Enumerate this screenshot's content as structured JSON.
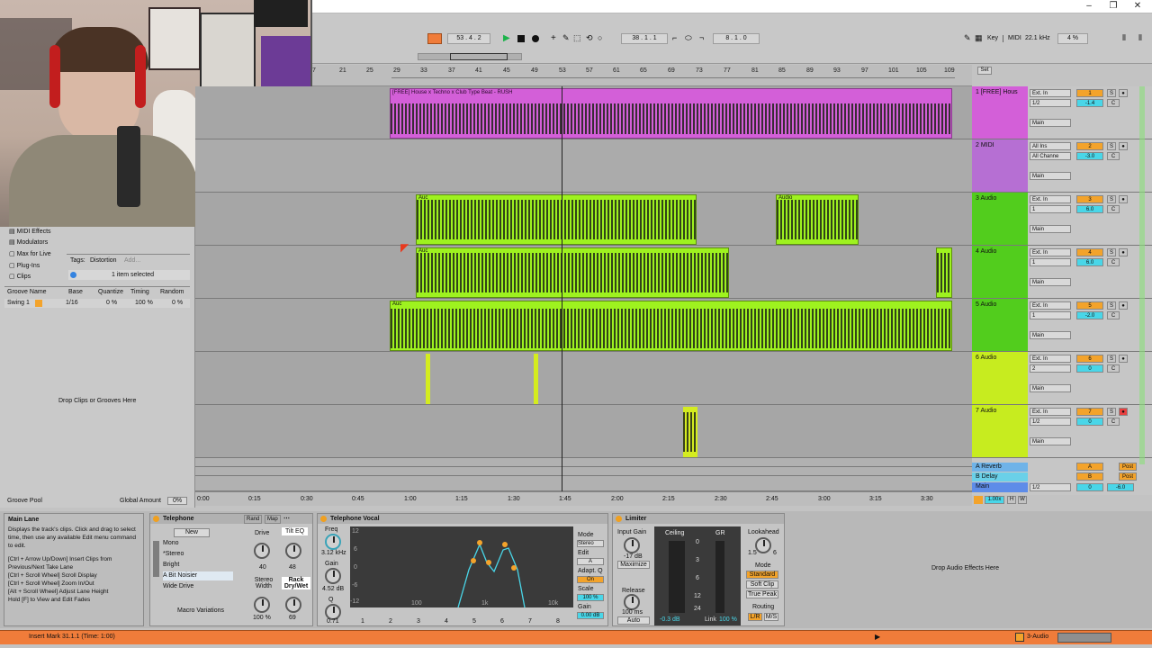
{
  "transport": {
    "position": "53 . 4 . 2",
    "loop_start": "38 . 1 . 1",
    "loop_length": "8 . 1 . 0",
    "key_label": "Key",
    "midi_label": "MIDI",
    "sample_rate": "22.1 kHz",
    "cpu": "4 %"
  },
  "ruler": {
    "bars": [
      "7",
      "21",
      "25",
      "29",
      "33",
      "37",
      "41",
      "45",
      "49",
      "53",
      "57",
      "61",
      "65",
      "69",
      "73",
      "77",
      "81",
      "85",
      "89",
      "93",
      "97",
      "101",
      "105",
      "109"
    ],
    "set_label": "Set"
  },
  "browser": {
    "categories": [
      "MIDI Effects",
      "Modulators",
      "Max for Live",
      "Plug-Ins",
      "Clips"
    ],
    "tags_label": "Tags:",
    "tag_value": "Distortion",
    "tag_add": "Add...",
    "selection_info": "1 item selected",
    "groove_headers": [
      "Groove Name",
      "Base",
      "Quantize",
      "Timing",
      "Random"
    ],
    "groove_row": {
      "name": "Swing 1",
      "base": "1/16",
      "quantize": "0 %",
      "timing": "100 %",
      "random": "0 %"
    },
    "drop_hint": "Drop Clips or Grooves Here",
    "groove_pool": "Groove Pool",
    "global_amount_label": "Global Amount",
    "global_amount": "0%"
  },
  "arrangement": {
    "clip1_name": "[FREE] House x Techno x Club Type Beat - RUSH",
    "audio_clip_label": "Audio",
    "short_clip_label": "Auc"
  },
  "tracks": [
    {
      "name": "1 [FREE] Hous",
      "input": "Ext. In",
      "channel": "1/2",
      "num": "1",
      "vol": "-1.4",
      "pan": "C",
      "output": "Main",
      "color": "#d35fd8"
    },
    {
      "name": "2 MIDI",
      "input": "All Ins",
      "channel": "All Channe",
      "num": "2",
      "vol": "-3.0",
      "pan": "C",
      "output": "Main",
      "color": "#b66fd3"
    },
    {
      "name": "3 Audio",
      "input": "Ext. In",
      "channel": "1",
      "num": "3",
      "vol": "6.0",
      "pan": "C",
      "output": "Main",
      "color": "#52cd1d"
    },
    {
      "name": "4 Audio",
      "input": "Ext. In",
      "channel": "1",
      "num": "4",
      "vol": "6.0",
      "pan": "C",
      "output": "Main",
      "color": "#52cd1d"
    },
    {
      "name": "5 Audio",
      "input": "Ext. In",
      "channel": "1",
      "num": "5",
      "vol": "-2.0",
      "pan": "C",
      "output": "Main",
      "color": "#52cd1d"
    },
    {
      "name": "6 Audio",
      "input": "Ext. In",
      "channel": "2",
      "num": "6",
      "vol": "0",
      "pan": "C",
      "output": "Main",
      "color": "#c7ec1f"
    },
    {
      "name": "7 Audio",
      "input": "Ext. In",
      "channel": "1/2",
      "num": "7",
      "vol": "0",
      "pan": "C",
      "output": "Main",
      "color": "#c7ec1f"
    }
  ],
  "returns": [
    {
      "name": "A Reverb",
      "letter": "A",
      "post": "Post"
    },
    {
      "name": "B Delay",
      "letter": "B",
      "post": "Post"
    },
    {
      "name": "Main",
      "channel": "1/2",
      "vol": "0",
      "pan": "-6.0"
    }
  ],
  "timeline": [
    "0:00",
    "0:15",
    "0:30",
    "0:45",
    "1:00",
    "1:15",
    "1:30",
    "1:45",
    "2:00",
    "2:15",
    "2:30",
    "2:45",
    "3:00",
    "3:15",
    "3:30"
  ],
  "zoom": "1.00x",
  "info": {
    "title": "Main Lane",
    "text1": "Displays the track's clips. Click and drag to select time, then use any available Edit menu command to edit.",
    "text2": "[Ctrl + Arrow Up/Down] Insert Clips from Previous/Next Take Lane",
    "text3": "[Ctrl + Scroll Wheel] Scroll Display",
    "text4": "[Ctrl + Scroll Wheel] Zoom In/Out",
    "text5": "[Alt + Scroll Wheel] Adjust Lane Height",
    "text6": "Hold [F] to View and Edit Fades"
  },
  "rack": {
    "title": "Telephone",
    "rand": "Rand",
    "map": "Map",
    "new_btn": "New",
    "chains": [
      "Mono",
      "*Stereo",
      "Bright",
      "A Bit Noisier",
      "Wide Drive"
    ],
    "drive_label": "Drive",
    "tilt_label": "Tilt EQ",
    "drive_val": "40",
    "tilt_val": "48",
    "stereo_width": "Stereo Width",
    "rack_drywet": "Rack Dry/Wet",
    "width_val": "100 %",
    "drywet_val": "69",
    "macro_variations": "Macro Variations"
  },
  "eq": {
    "title": "Telephone Vocal",
    "freq_label": "Freq",
    "freq_val": "3.12 kHz",
    "gain_label": "Gain",
    "gain_val": "4.52 dB",
    "q_label": "Q",
    "q_val": "0.71",
    "mode_label": "Mode",
    "mode_val": "Stereo",
    "edit_label": "Edit",
    "edit_val": "A",
    "adapt_label": "Adapt. Q",
    "adapt_val": "On",
    "scale_label": "Scale",
    "scale_val": "100 %",
    "gain2_label": "Gain",
    "gain2_val": "0.00 dB",
    "y_labels": [
      "12",
      "6",
      "0",
      "-6",
      "-12"
    ],
    "x_labels": [
      "100",
      "1k",
      "10k"
    ],
    "bands": [
      "1",
      "2",
      "3",
      "4",
      "5",
      "6",
      "7",
      "8"
    ]
  },
  "limiter": {
    "title": "Limiter",
    "input_gain": "Input Gain",
    "input_val": "-17 dB",
    "maximize": "Maximize",
    "release": "Release",
    "release_val": "100 ms",
    "auto": "Auto",
    "ceiling": "Ceiling",
    "gr": "GR",
    "ceiling_val": "-0.3 dB",
    "link": "Link",
    "link_val": "100 %",
    "meter_scale": [
      "0",
      "3",
      "6",
      "12",
      "24"
    ],
    "lookahead": "Lookahead",
    "look_vals": [
      "1.5",
      "6"
    ],
    "mode": "Mode",
    "modes": [
      "Standard",
      "Soft Clip",
      "True Peak"
    ],
    "routing": "Routing",
    "routing_vals": [
      "L/R",
      "M/S"
    ]
  },
  "drop_audio": "Drop Audio Effects Here",
  "status": {
    "text": "Insert Mark 31.1.1 (Time: 1:00)",
    "track": "3-Audio"
  }
}
